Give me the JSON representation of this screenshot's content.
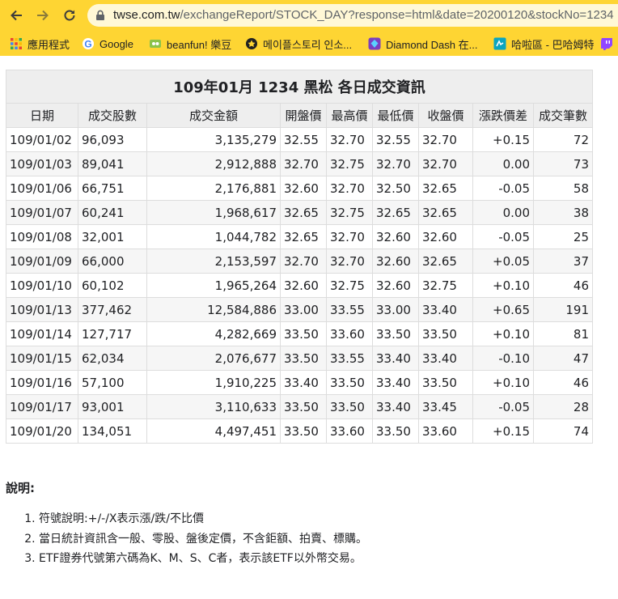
{
  "browser": {
    "url_host": "twse.com.tw",
    "url_path": "/exchangeReport/STOCK_DAY?response=html&date=20200120&stockNo=1234",
    "bookmarks": [
      {
        "label": "應用程式",
        "icon": "apps-grid-icon"
      },
      {
        "label": "Google",
        "icon": "google-logo-icon"
      },
      {
        "label": "beanfun! 樂豆",
        "icon": "beanfun-icon"
      },
      {
        "label": "메이플스토리 인소...",
        "icon": "maplestory-icon"
      },
      {
        "label": "Diamond Dash 在...",
        "icon": "diamond-icon"
      },
      {
        "label": "哈啦區 - 巴哈姆特",
        "icon": "bahamut-icon"
      }
    ]
  },
  "report": {
    "title": "109年01月 1234 黑松 各日成交資訊",
    "columns": [
      "日期",
      "成交股數",
      "成交金額",
      "開盤價",
      "最高價",
      "最低價",
      "收盤價",
      "漲跌價差",
      "成交筆數"
    ],
    "rows": [
      [
        "109/01/02",
        "96,093",
        "3,135,279",
        "32.55",
        "32.70",
        "32.55",
        "32.70",
        "+0.15",
        "72"
      ],
      [
        "109/01/03",
        "89,041",
        "2,912,888",
        "32.70",
        "32.75",
        "32.70",
        "32.70",
        "0.00",
        "73"
      ],
      [
        "109/01/06",
        "66,751",
        "2,176,881",
        "32.60",
        "32.70",
        "32.50",
        "32.65",
        "-0.05",
        "58"
      ],
      [
        "109/01/07",
        "60,241",
        "1,968,617",
        "32.65",
        "32.75",
        "32.65",
        "32.65",
        "0.00",
        "38"
      ],
      [
        "109/01/08",
        "32,001",
        "1,044,782",
        "32.65",
        "32.70",
        "32.60",
        "32.60",
        "-0.05",
        "25"
      ],
      [
        "109/01/09",
        "66,000",
        "2,153,597",
        "32.70",
        "32.70",
        "32.60",
        "32.65",
        "+0.05",
        "37"
      ],
      [
        "109/01/10",
        "60,102",
        "1,965,264",
        "32.60",
        "32.75",
        "32.60",
        "32.75",
        "+0.10",
        "46"
      ],
      [
        "109/01/13",
        "377,462",
        "12,584,886",
        "33.00",
        "33.55",
        "33.00",
        "33.40",
        "+0.65",
        "191"
      ],
      [
        "109/01/14",
        "127,717",
        "4,282,669",
        "33.50",
        "33.60",
        "33.50",
        "33.50",
        "+0.10",
        "81"
      ],
      [
        "109/01/15",
        "62,034",
        "2,076,677",
        "33.50",
        "33.55",
        "33.40",
        "33.40",
        "-0.10",
        "47"
      ],
      [
        "109/01/16",
        "57,100",
        "1,910,225",
        "33.40",
        "33.50",
        "33.40",
        "33.50",
        "+0.10",
        "46"
      ],
      [
        "109/01/17",
        "93,001",
        "3,110,633",
        "33.50",
        "33.50",
        "33.40",
        "33.45",
        "-0.05",
        "28"
      ],
      [
        "109/01/20",
        "134,051",
        "4,497,451",
        "33.50",
        "33.60",
        "33.50",
        "33.60",
        "+0.15",
        "74"
      ]
    ]
  },
  "notes": {
    "heading": "說明:",
    "items": [
      "符號說明:+/-/X表示漲/跌/不比價",
      "當日統計資訊含一般、零股、盤後定價，不含鉅額、拍賣、標購。",
      "ETF證券代號第六碼為K、M、S、C者，表示該ETF以外幣交易。"
    ]
  }
}
